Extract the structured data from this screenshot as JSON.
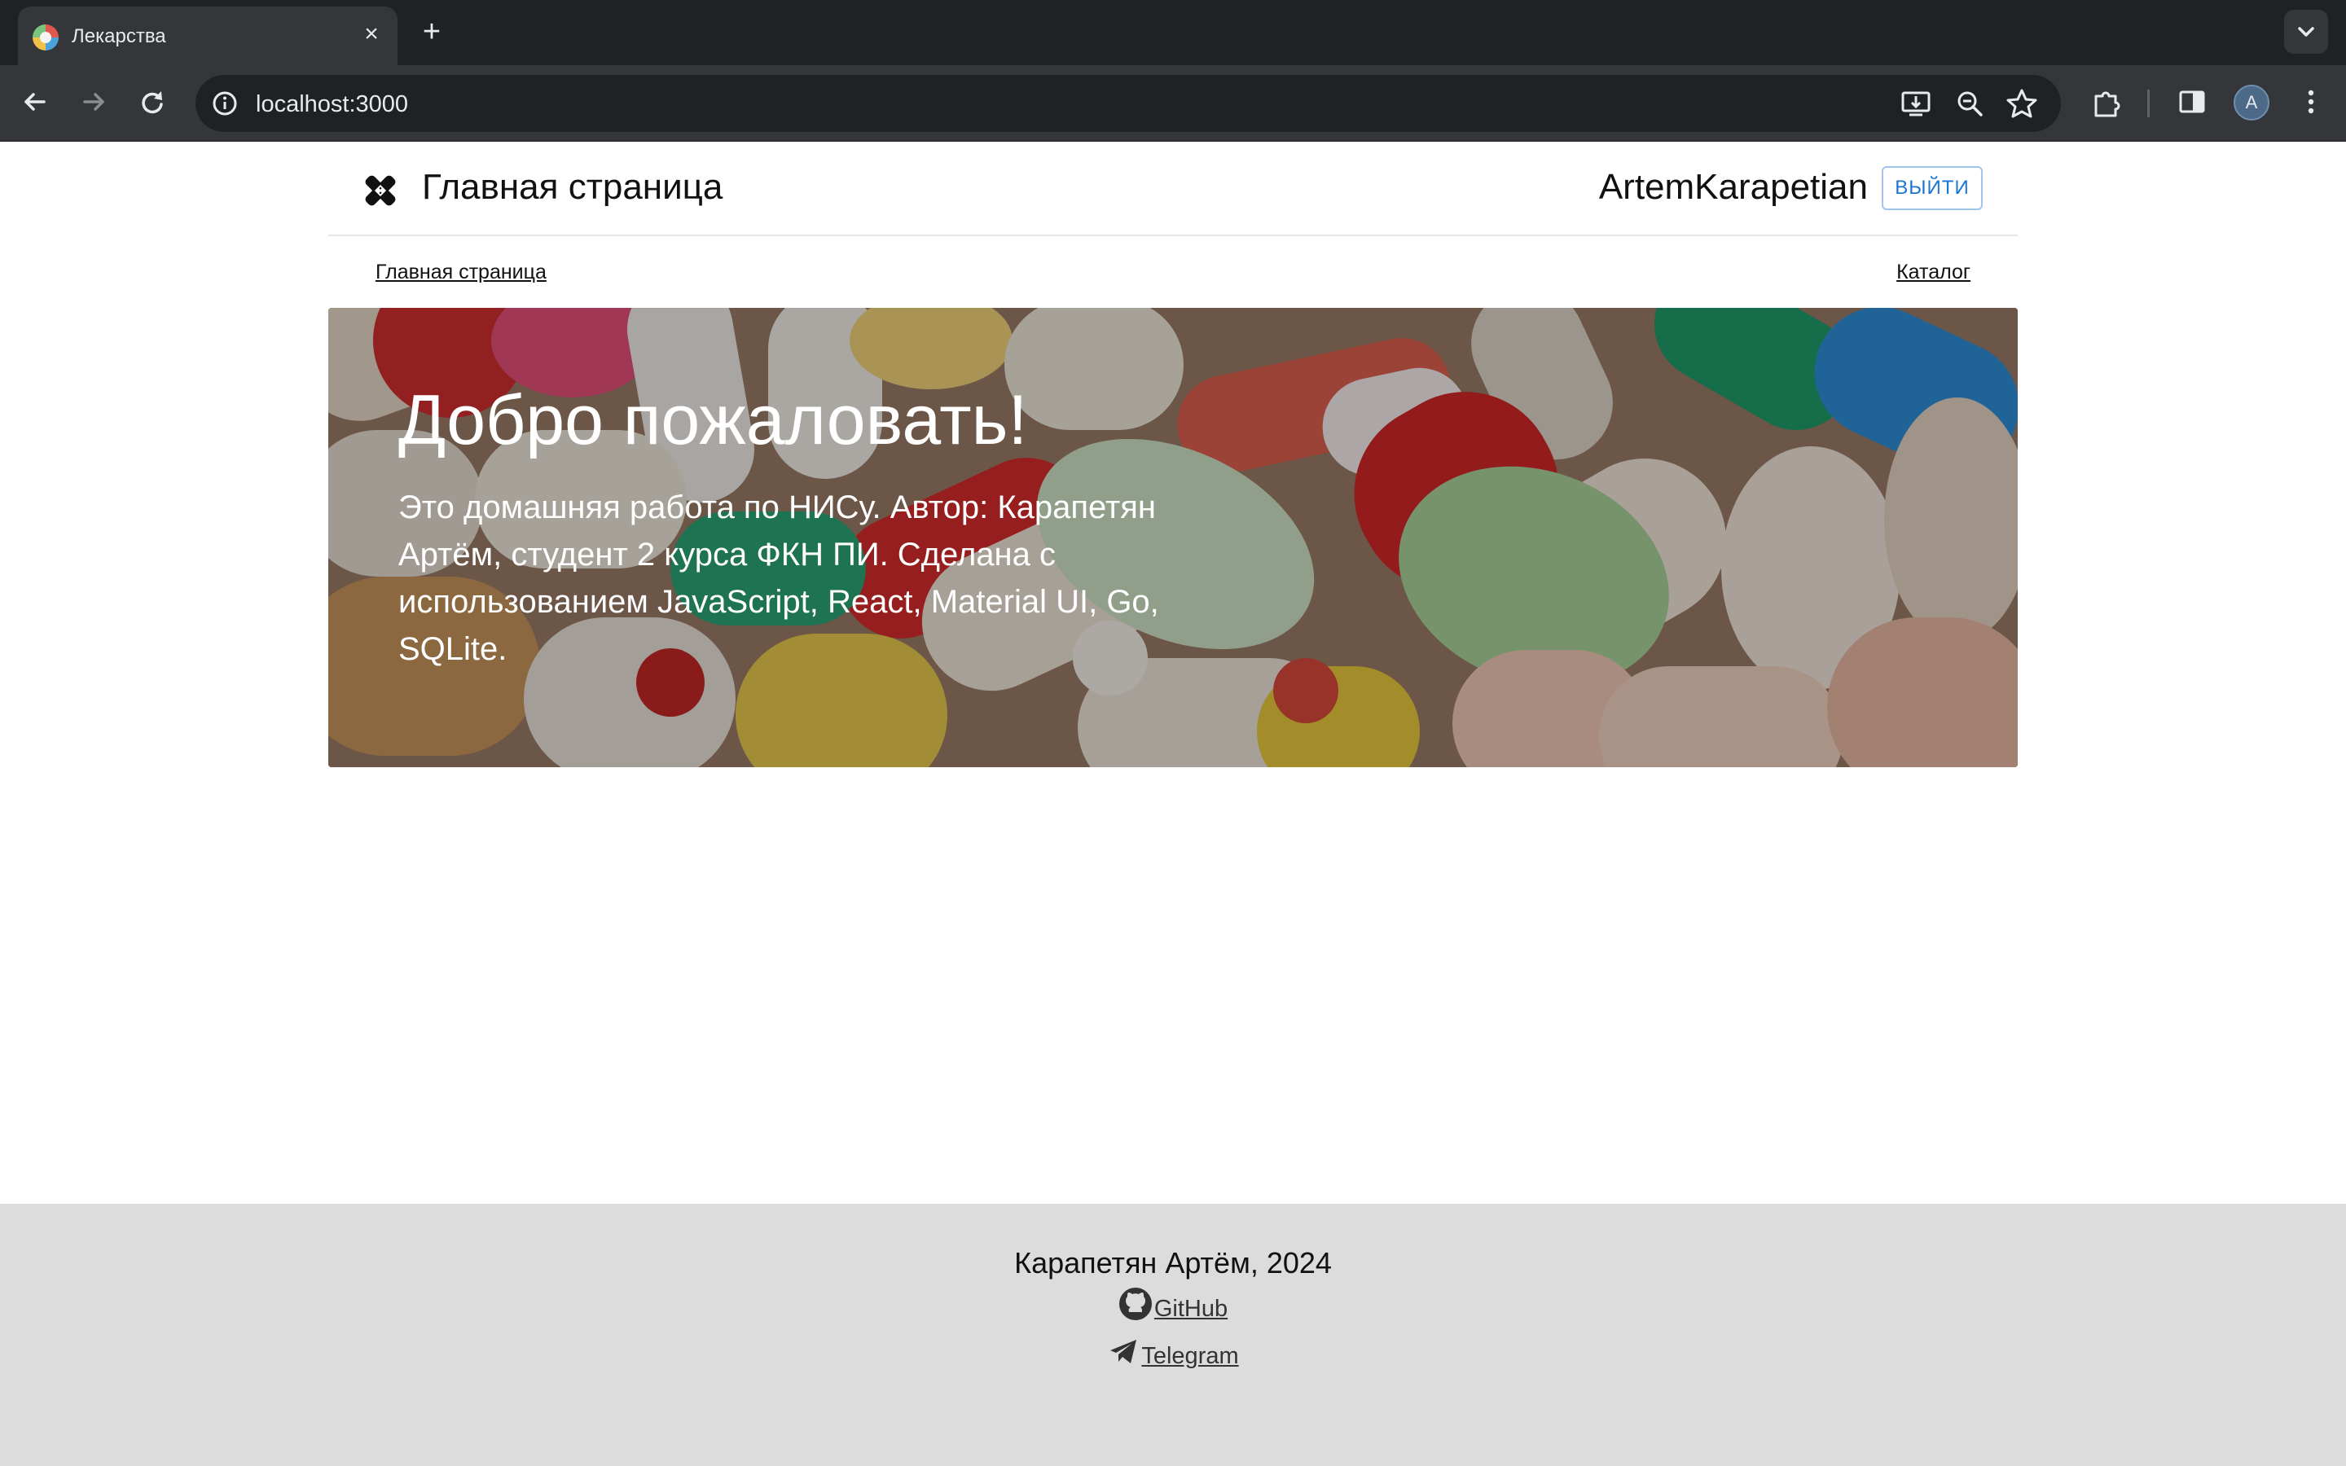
{
  "browser": {
    "tab_title": "Лекарства",
    "tab_close": "×",
    "new_tab": "+",
    "url": "localhost:3000",
    "profile_initial": "A"
  },
  "header": {
    "title": "Главная страница",
    "username": "ArtemKarapetian",
    "logout_label": "ВЫЙТИ"
  },
  "nav": {
    "home_label": "Главная страница",
    "catalog_label": "Каталог"
  },
  "hero": {
    "title": "Добро пожаловать!",
    "text": "Это домашняя работа по НИСу. Автор: Карапетян Артём, студент 2 курса ФКН ПИ. Сделана с использованием JavaScript, React, Material UI, Go, SQLite."
  },
  "footer": {
    "copyright": "Карапетян Артём, 2024",
    "links": [
      {
        "label": "GitHub",
        "icon": "github-icon"
      },
      {
        "label": "Telegram",
        "icon": "telegram-icon"
      }
    ]
  },
  "colors": {
    "accent": "#1976d2",
    "footer_bg": "#dcdcdc",
    "chrome_bg": "#202124"
  }
}
